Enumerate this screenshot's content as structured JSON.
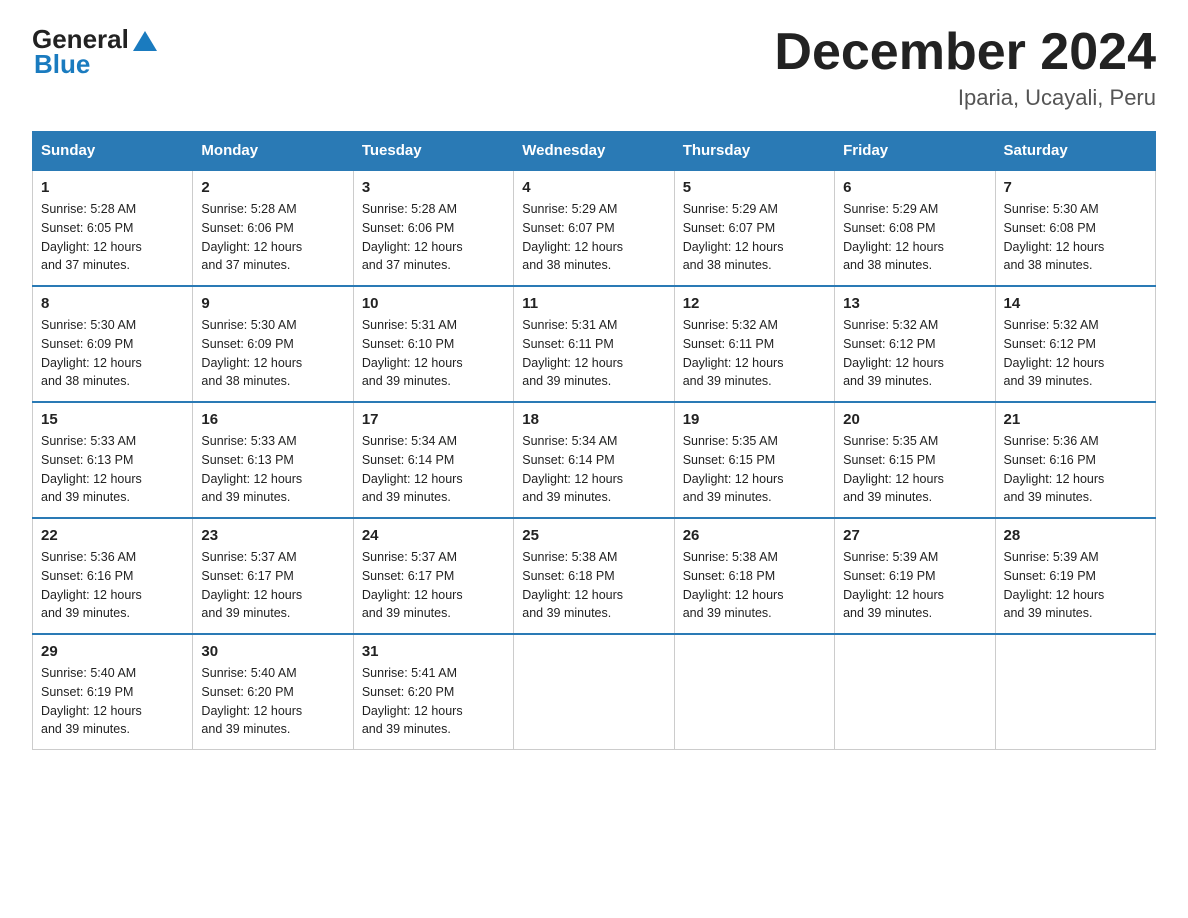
{
  "logo": {
    "text_general": "General",
    "text_blue": "Blue",
    "triangle_label": "logo-triangle"
  },
  "title": "December 2024",
  "subtitle": "Iparia, Ucayali, Peru",
  "header_days": [
    "Sunday",
    "Monday",
    "Tuesday",
    "Wednesday",
    "Thursday",
    "Friday",
    "Saturday"
  ],
  "weeks": [
    [
      {
        "day": "1",
        "sunrise": "5:28 AM",
        "sunset": "6:05 PM",
        "daylight": "12 hours and 37 minutes."
      },
      {
        "day": "2",
        "sunrise": "5:28 AM",
        "sunset": "6:06 PM",
        "daylight": "12 hours and 37 minutes."
      },
      {
        "day": "3",
        "sunrise": "5:28 AM",
        "sunset": "6:06 PM",
        "daylight": "12 hours and 37 minutes."
      },
      {
        "day": "4",
        "sunrise": "5:29 AM",
        "sunset": "6:07 PM",
        "daylight": "12 hours and 38 minutes."
      },
      {
        "day": "5",
        "sunrise": "5:29 AM",
        "sunset": "6:07 PM",
        "daylight": "12 hours and 38 minutes."
      },
      {
        "day": "6",
        "sunrise": "5:29 AM",
        "sunset": "6:08 PM",
        "daylight": "12 hours and 38 minutes."
      },
      {
        "day": "7",
        "sunrise": "5:30 AM",
        "sunset": "6:08 PM",
        "daylight": "12 hours and 38 minutes."
      }
    ],
    [
      {
        "day": "8",
        "sunrise": "5:30 AM",
        "sunset": "6:09 PM",
        "daylight": "12 hours and 38 minutes."
      },
      {
        "day": "9",
        "sunrise": "5:30 AM",
        "sunset": "6:09 PM",
        "daylight": "12 hours and 38 minutes."
      },
      {
        "day": "10",
        "sunrise": "5:31 AM",
        "sunset": "6:10 PM",
        "daylight": "12 hours and 39 minutes."
      },
      {
        "day": "11",
        "sunrise": "5:31 AM",
        "sunset": "6:11 PM",
        "daylight": "12 hours and 39 minutes."
      },
      {
        "day": "12",
        "sunrise": "5:32 AM",
        "sunset": "6:11 PM",
        "daylight": "12 hours and 39 minutes."
      },
      {
        "day": "13",
        "sunrise": "5:32 AM",
        "sunset": "6:12 PM",
        "daylight": "12 hours and 39 minutes."
      },
      {
        "day": "14",
        "sunrise": "5:32 AM",
        "sunset": "6:12 PM",
        "daylight": "12 hours and 39 minutes."
      }
    ],
    [
      {
        "day": "15",
        "sunrise": "5:33 AM",
        "sunset": "6:13 PM",
        "daylight": "12 hours and 39 minutes."
      },
      {
        "day": "16",
        "sunrise": "5:33 AM",
        "sunset": "6:13 PM",
        "daylight": "12 hours and 39 minutes."
      },
      {
        "day": "17",
        "sunrise": "5:34 AM",
        "sunset": "6:14 PM",
        "daylight": "12 hours and 39 minutes."
      },
      {
        "day": "18",
        "sunrise": "5:34 AM",
        "sunset": "6:14 PM",
        "daylight": "12 hours and 39 minutes."
      },
      {
        "day": "19",
        "sunrise": "5:35 AM",
        "sunset": "6:15 PM",
        "daylight": "12 hours and 39 minutes."
      },
      {
        "day": "20",
        "sunrise": "5:35 AM",
        "sunset": "6:15 PM",
        "daylight": "12 hours and 39 minutes."
      },
      {
        "day": "21",
        "sunrise": "5:36 AM",
        "sunset": "6:16 PM",
        "daylight": "12 hours and 39 minutes."
      }
    ],
    [
      {
        "day": "22",
        "sunrise": "5:36 AM",
        "sunset": "6:16 PM",
        "daylight": "12 hours and 39 minutes."
      },
      {
        "day": "23",
        "sunrise": "5:37 AM",
        "sunset": "6:17 PM",
        "daylight": "12 hours and 39 minutes."
      },
      {
        "day": "24",
        "sunrise": "5:37 AM",
        "sunset": "6:17 PM",
        "daylight": "12 hours and 39 minutes."
      },
      {
        "day": "25",
        "sunrise": "5:38 AM",
        "sunset": "6:18 PM",
        "daylight": "12 hours and 39 minutes."
      },
      {
        "day": "26",
        "sunrise": "5:38 AM",
        "sunset": "6:18 PM",
        "daylight": "12 hours and 39 minutes."
      },
      {
        "day": "27",
        "sunrise": "5:39 AM",
        "sunset": "6:19 PM",
        "daylight": "12 hours and 39 minutes."
      },
      {
        "day": "28",
        "sunrise": "5:39 AM",
        "sunset": "6:19 PM",
        "daylight": "12 hours and 39 minutes."
      }
    ],
    [
      {
        "day": "29",
        "sunrise": "5:40 AM",
        "sunset": "6:19 PM",
        "daylight": "12 hours and 39 minutes."
      },
      {
        "day": "30",
        "sunrise": "5:40 AM",
        "sunset": "6:20 PM",
        "daylight": "12 hours and 39 minutes."
      },
      {
        "day": "31",
        "sunrise": "5:41 AM",
        "sunset": "6:20 PM",
        "daylight": "12 hours and 39 minutes."
      },
      null,
      null,
      null,
      null
    ]
  ],
  "labels": {
    "sunrise": "Sunrise:",
    "sunset": "Sunset:",
    "daylight": "Daylight:"
  }
}
